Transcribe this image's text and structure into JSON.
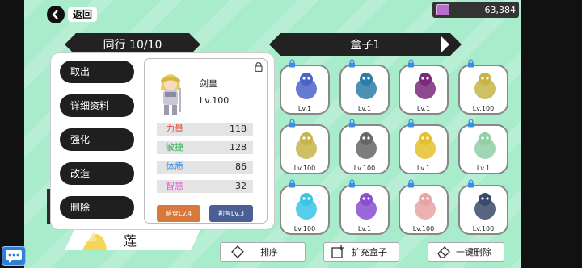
{
  "top": {
    "back_label": "返回",
    "currency_value": "63,384",
    "currency_icon": "gem-book-icon"
  },
  "banners": {
    "companion": "同行 10/10",
    "box": "盒子1"
  },
  "menu": [
    "取出",
    "详细资料",
    "强化",
    "改造",
    "删除"
  ],
  "hero": {
    "name": "剑皇",
    "level": "Lv.100",
    "stats": [
      {
        "label": "力量",
        "value": "118",
        "color": "#e0553c"
      },
      {
        "label": "敏捷",
        "value": "128",
        "color": "#2fb457"
      },
      {
        "label": "体质",
        "value": "86",
        "color": "#3c8fe0"
      },
      {
        "label": "智慧",
        "value": "32",
        "color": "#e35ad8"
      }
    ],
    "skills": [
      {
        "label": "暗穿Lv.4",
        "color": "#d8783a"
      },
      {
        "label": "初智Lv.3",
        "color": "#4a5f96"
      }
    ]
  },
  "box_slots": [
    {
      "level": "Lv.1",
      "creature": "blue-dragon-icon",
      "color": "#4a63c9"
    },
    {
      "level": "Lv.1",
      "creature": "blue-demon-icon",
      "color": "#2a7ea6"
    },
    {
      "level": "Lv.1",
      "creature": "dark-knight-icon",
      "color": "#7a2a7a"
    },
    {
      "level": "Lv.100",
      "creature": "blonde-knight-icon",
      "color": "#c7b44a"
    },
    {
      "level": "Lv.100",
      "creature": "blonde-knight-icon",
      "color": "#c7b44a"
    },
    {
      "level": "Lv.100",
      "creature": "silver-hair-girl-icon",
      "color": "#666666"
    },
    {
      "level": "Lv.1",
      "creature": "yellow-bird-icon",
      "color": "#e4c02c"
    },
    {
      "level": "Lv.1",
      "creature": "white-dragon-icon",
      "color": "#8fd0a6"
    },
    {
      "level": "Lv.100",
      "creature": "ice-spirit-icon",
      "color": "#38c5e6"
    },
    {
      "level": "Lv.1",
      "creature": "purple-slime-icon",
      "color": "#8a4fd0"
    },
    {
      "level": "Lv.100",
      "creature": "pink-hair-girl-icon",
      "color": "#e7a3a6"
    },
    {
      "level": "Lv.100",
      "creature": "dark-mage-icon",
      "color": "#3a4a6a"
    }
  ],
  "bottom": {
    "sort_label": "排序",
    "expand_label": "扩充盒子",
    "delete_all_label": "一键删除",
    "companion_name": "莲"
  }
}
